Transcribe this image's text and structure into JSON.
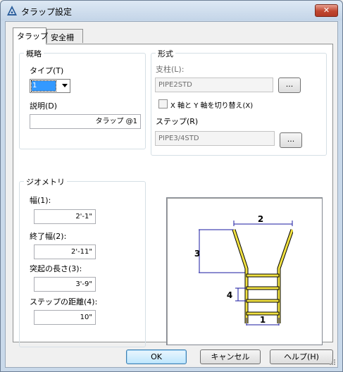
{
  "window": {
    "title": "タラップ設定",
    "close_label": "✕"
  },
  "tabs": [
    {
      "label": "タラップ"
    },
    {
      "label": "安全柵"
    }
  ],
  "overview": {
    "group_title": "概略",
    "type_label": "タイプ(T)",
    "type_value": "1",
    "description_label": "説明(D)",
    "description_value": "タラップ @1"
  },
  "form": {
    "group_title": "形式",
    "support_label": "支柱(L):",
    "support_value": "PIPE2STD",
    "support_browse": "...",
    "swap_axes_label": "X 軸と Y 軸を切り替え(X)",
    "swap_axes_checked": false,
    "step_label": "ステップ(R)",
    "step_value": "PIPE3/4STD",
    "step_browse": "..."
  },
  "geometry": {
    "group_title": "ジオメトリ",
    "width_label": "幅(1):",
    "width_value": "2'-1\"",
    "end_width_label": "終了幅(2):",
    "end_width_value": "2'-11\"",
    "protrusion_label": "突起の長さ(3):",
    "protrusion_value": "3'-9\"",
    "step_distance_label": "ステップの距離(4):",
    "step_distance_value": "10\""
  },
  "preview": {
    "labels": {
      "one": "1",
      "two": "2",
      "three": "3",
      "four": "4"
    },
    "colors": {
      "ladder": "#f0e040",
      "dimension": "#1a1aa0",
      "outline": "#000000"
    }
  },
  "footer": {
    "ok_label": "OK",
    "cancel_label": "キャンセル",
    "help_label": "ヘルプ(H)"
  }
}
